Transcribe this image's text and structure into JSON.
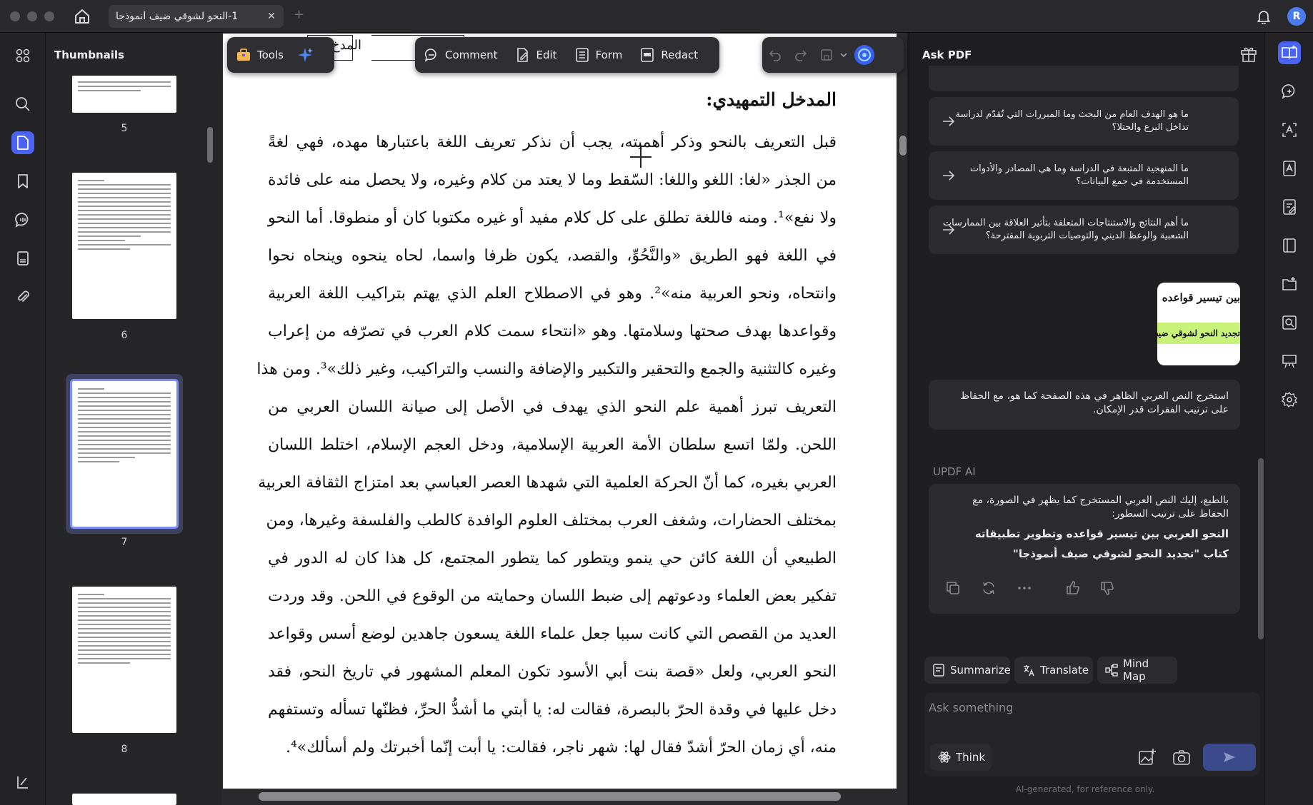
{
  "window": {
    "tab_title": "1-النحو لشوقي ضيف أنموذجا",
    "tab_close": "✕",
    "new_tab": "+",
    "avatar_letter": "R"
  },
  "thumbnails": {
    "title": "Thumbnails",
    "pages": [
      {
        "number": "5"
      },
      {
        "number": "6"
      },
      {
        "number": "7",
        "selected": true
      },
      {
        "number": "8"
      }
    ]
  },
  "toolbar": {
    "tools": "Tools",
    "comment": "Comment",
    "edit": "Edit",
    "form": "Form",
    "redact": "Redact"
  },
  "document": {
    "header_fragment": "المدخ",
    "heading": "المدخل التمهيدي:",
    "lines": [
      "قبل التعريف بالنحو وذكر أهميته، يجب أن نذكر تعريف اللغة باعتبارها مهده، فهي لغةً",
      "من الجذر «لغا: اللغو واللغا: السّقط وما لا يعتد من كلام وغيره، ولا يحصل منه على فائدة",
      "ولا نفع»¹. ومنه فاللغة تطلق على كل كلام مفيد أو غيره مكتوبا كان أو منطوقا. أما النحو",
      "في اللغة فهو الطريق «والنَّحُوِّ، والقصد، يكون ظرفا واسما، لحاه ينحوه وينحاه نحوا",
      "وانتحاه، ونحو العربية منه»². وهو في الاصطلاح العلم الذي يهتم بتراكيب اللغة العربية",
      "وقواعدها بهدف صحتها وسلامتها. وهو «انتحاء سمت كلام العرب في تصرّفه من إعراب",
      "وغيره كالتثنية والجمع والتحقير والتكبير والإضافة والنسب والتراكيب، وغير ذلك»³. ومن هذا",
      "التعريف تبرز أهمية علم النحو الذي يهدف في الأصل إلى صيانة اللسان العربي من",
      "اللحن. ولمّا اتسع سلطان الأمة العربية الإسلامية، ودخل العجم الإسلام، اختلط اللسان",
      "العربي بغيره، كما أنّ الحركة العلمية التي شهدها العصر العباسي بعد امتزاج الثقافة العربية",
      "بمختلف الحضارات، وشغف العرب بمختلف العلوم الوافدة كالطب والفلسفة وغيرها، ومن",
      "الطبيعي أن اللغة كائن حي ينمو ويتطور كما يتطور المجتمع، كل هذا كان له الدور في",
      "تفكير بعض العلماء ودعوتهم إلى ضبط اللسان وحمايته من الوقوع في اللحن. وقد وردت",
      "العديد من القصص التي كانت سببا جعل علماء اللغة يسعون جاهدين لوضع أسس وقواعد",
      "النحو العربي، ولعل «قصة بنت أبي الأسود تكون المعلم المشهور في تاريخ النحو، فقد",
      "دخل عليها في وقدة الحرّ بالبصرة، فقالت له: يا أبتي ما أشدُّ الحرِّ، فظنّها تسأله وتستفهم",
      "منه، أي زمان الحرّ أشدّ فقال لها: شهر ناجر، فقالت: يا أبت إنّما أخبرتك ولم أسألك»⁴."
    ]
  },
  "ask_pdf": {
    "title": "Ask PDF",
    "suggestions": [
      "ما هو الهدف العام من البحث وما المبررات التي تُقدّم لدراسة تداخل البرع والحتلا؟",
      "ما المنهجية المتبعة في الدراسة وما هي المصادر والأدوات المستخدمة في جمع البيانات؟",
      "ما أهم النتائج والاستنتاجات المتعلقة بتأثير العلاقة بين الممارسات الشعبية والوعظ الديني والتوصيات التربوية المقترحة؟"
    ],
    "image_bubble": {
      "line1": "بين تيسير قواعده",
      "line2": "تجديد النحو لشوقي ضيف"
    },
    "user_message": "استخرج النص العربي الظاهر في هذه الصفحة كما هو، مع الحفاظ على ترتيب الفقرات قدر الإمكان.",
    "ai_label": "UPDF AI",
    "ai_response": {
      "intro": "بالطبع، إليك النص العربي المستخرج كما يظهر في الصورة، مع الحفاظ على ترتيب السطور:",
      "line1": "النحو العربي بين تيسير قواعده وتطوير تطبيقاته",
      "line2": "كتاب \"تجديد النحو لشوقي ضيف أنموذجا\""
    },
    "chips": {
      "summarize": "Summarize",
      "translate": "Translate",
      "mind_map": "Mind Map"
    },
    "input_placeholder": "Ask something",
    "input_value": "",
    "think": "Think",
    "disclaimer": "AI-generated, for reference only."
  },
  "colors": {
    "accent": "#4a63f0",
    "highlight": "#c9f27a",
    "panel_bg": "#1f1f22",
    "page_bg": "#ffffff"
  }
}
